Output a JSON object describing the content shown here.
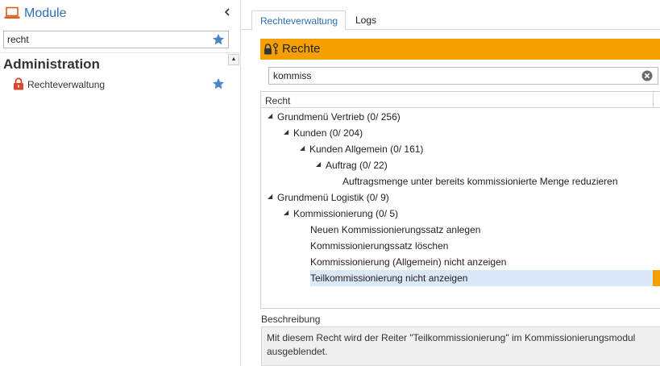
{
  "sidebar": {
    "title": "Module",
    "search_value": "recht",
    "section": "Administration",
    "items": [
      {
        "label": "Rechteverwaltung"
      }
    ]
  },
  "tabs": [
    {
      "label": "Rechteverwaltung",
      "active": true
    },
    {
      "label": "Logs",
      "active": false
    }
  ],
  "panel": {
    "title": "Rechte",
    "filter_value": "kommiss",
    "column_header": "Recht"
  },
  "tree": [
    {
      "label": "Grundmenü Vertrieb (0/ 256)"
    },
    {
      "label": "Kunden (0/ 204)"
    },
    {
      "label": "Kunden Allgemein (0/ 161)"
    },
    {
      "label": "Auftrag (0/ 22)"
    },
    {
      "label": "Auftragsmenge unter bereits kommissionierte Menge reduzieren"
    },
    {
      "label": "Grundmenü Logistik (0/ 9)"
    },
    {
      "label": "Kommissionierung (0/ 5)"
    },
    {
      "label": "Neuen Kommissionierungssatz anlegen"
    },
    {
      "label": "Kommissionierungssatz löschen"
    },
    {
      "label": "Kommissionierung (Allgemein) nicht anzeigen"
    },
    {
      "label": "Teilkommissionierung nicht anzeigen"
    }
  ],
  "description": {
    "label": "Beschreibung",
    "text": "Mit diesem Recht wird der Reiter \"Teilkommissionierung\" im Kommissionierungsmodul ausgeblendet."
  },
  "colors": {
    "accent_orange": "#f5a000",
    "link_blue": "#2e6fb5",
    "module_icon": "#e05a1e",
    "lock_red": "#d9472b",
    "star_blue": "#4a86c5",
    "selection": "#dae8f7"
  },
  "icons": {
    "module": "laptop-icon",
    "collapse": "chevron-left-icon",
    "favorite": "star-icon",
    "lock": "lock-icon",
    "rights": "lock-key-icon",
    "clear": "clear-circle-icon",
    "expand": "triangle-down-icon"
  }
}
